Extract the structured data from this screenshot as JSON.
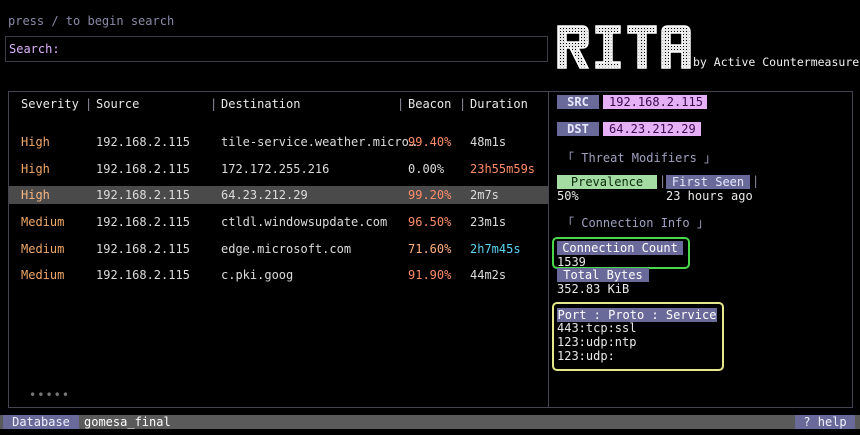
{
  "search": {
    "hint": "press / to begin search",
    "label": "Search:",
    "value": "",
    "placeholder": ""
  },
  "brand": {
    "logo_text": "RITA",
    "byline": "by Active Countermeasures©"
  },
  "table": {
    "headers": {
      "severity": "Severity",
      "source": "Source",
      "destination": "Destination",
      "beacon": "Beacon",
      "duration": "Duration"
    },
    "separator": "|",
    "rows": [
      {
        "severity": "High",
        "source": "192.168.2.115",
        "destination": "tile-service.weather.micro…",
        "beacon": "99.40%",
        "duration": "48m1s"
      },
      {
        "severity": "High",
        "source": "192.168.2.115",
        "destination": "172.172.255.216",
        "beacon": "0.00%",
        "duration": "23h55m59s"
      },
      {
        "severity": "High",
        "source": "192.168.2.115",
        "destination": "64.23.212.29",
        "beacon": "99.20%",
        "duration": "2m7s"
      },
      {
        "severity": "Medium",
        "source": "192.168.2.115",
        "destination": "ctldl.windowsupdate.com",
        "beacon": "96.50%",
        "duration": "23m1s"
      },
      {
        "severity": "Medium",
        "source": "192.168.2.115",
        "destination": "edge.microsoft.com",
        "beacon": "71.60%",
        "duration": "2h7m45s"
      },
      {
        "severity": "Medium",
        "source": "192.168.2.115",
        "destination": "c.pki.goog",
        "beacon": "91.90%",
        "duration": "44m2s"
      }
    ],
    "pagination_dots": "•••••"
  },
  "details": {
    "src_label": "SRC",
    "src_value": "192.168.2.115",
    "dst_label": "DST",
    "dst_value": "64.23.212.29",
    "threat_modifiers_title": "「 Threat Modifiers 」",
    "prevalence_label": "Prevalence",
    "prevalence_value": "50%",
    "first_seen_label": "First Seen",
    "first_seen_value": "23 hours ago",
    "connection_info_title": "「 Connection Info 」",
    "connection_count_label": "Connection Count",
    "connection_count_value": "1539",
    "total_bytes_label": "Total Bytes",
    "total_bytes_value": "352.83 KiB",
    "port_proto_label": "Port : Proto : Service",
    "ports": [
      "443:tcp:ssl",
      "123:udp:ntp",
      "123:udp:"
    ]
  },
  "statusbar": {
    "db_label": "Database",
    "db_name": "gomesa_final",
    "help": "? help"
  },
  "colors": {
    "background": "#000000",
    "accent_purple": "#6a6a9a",
    "pink_value_bg": "#e6b0f7",
    "severity_high": "#f0a86a",
    "selected_row_bg": "#4a4a4a",
    "highlight_green": "#4ad84a",
    "highlight_yellow": "#e6e68a"
  }
}
